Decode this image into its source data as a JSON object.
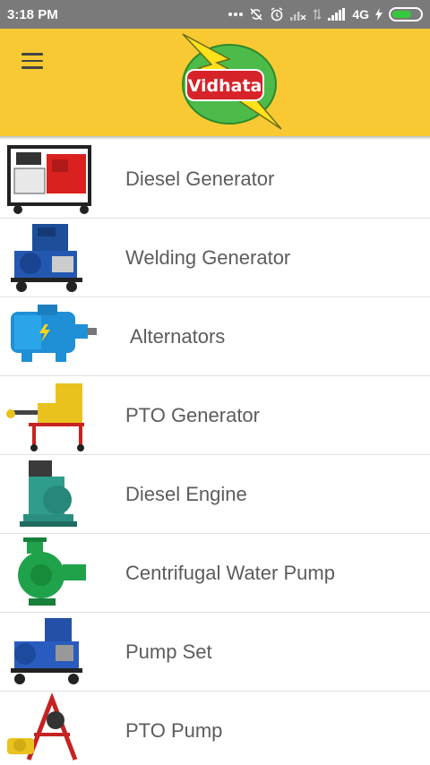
{
  "status_bar": {
    "time": "3:18 PM",
    "network": "4G",
    "battery_level": 0.7,
    "icons": [
      "more-dots-icon",
      "sync-off-icon",
      "alarm-icon",
      "signal-x-icon",
      "data-arrows-icon",
      "signal-bars-icon",
      "charging-icon",
      "battery-icon"
    ]
  },
  "app_bar": {
    "menu_icon": "hamburger-menu-icon",
    "logo_text": "Vidhata",
    "colors": {
      "background": "#f8c932",
      "logo_green": "#4cbb4a",
      "logo_red": "#d6232a",
      "bolt_yellow": "#ffe21a"
    }
  },
  "products": [
    {
      "label": "Diesel Generator",
      "image": "diesel-generator-image"
    },
    {
      "label": "Welding Generator",
      "image": "welding-generator-image"
    },
    {
      "label": " Alternators",
      "image": "alternator-image"
    },
    {
      "label": "PTO Generator",
      "image": "pto-generator-image"
    },
    {
      "label": "Diesel Engine",
      "image": "diesel-engine-image"
    },
    {
      "label": "Centrifugal Water Pump",
      "image": "centrifugal-pump-image"
    },
    {
      "label": "Pump Set",
      "image": "pump-set-image"
    },
    {
      "label": "PTO Pump",
      "image": "pto-pump-image"
    }
  ]
}
